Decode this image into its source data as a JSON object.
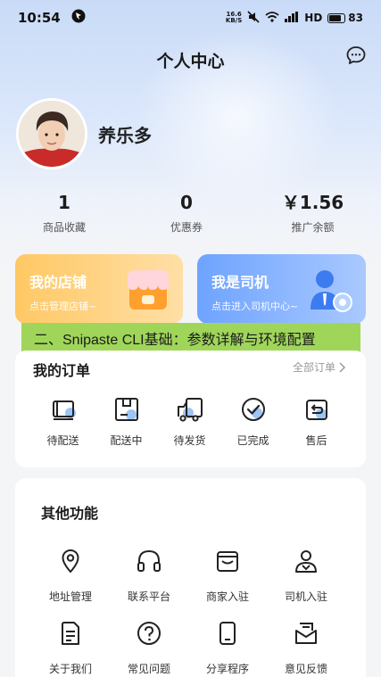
{
  "status_bar": {
    "time": "10:54",
    "net_speed_value": "16.6",
    "net_speed_unit": "KB/S",
    "network": "HD",
    "battery": "83"
  },
  "header": {
    "title": "个人中心",
    "message_icon": "chat-bubble-icon"
  },
  "profile": {
    "name": "养乐多"
  },
  "stats": [
    {
      "value": "1",
      "label": "商品收藏"
    },
    {
      "value": "0",
      "label": "优惠券"
    },
    {
      "value": "￥1.56",
      "label": "推广余额"
    }
  ],
  "promos": [
    {
      "title": "我的店铺",
      "subtitle": "点击管理店铺~",
      "icon": "shop-icon",
      "color": "#ffc864"
    },
    {
      "title": "我是司机",
      "subtitle": "点击进入司机中心~",
      "icon": "driver-icon",
      "color": "#6ea3ff"
    }
  ],
  "overlay_banner": {
    "text": "二、Snipaste CLI基础：参数详解与环境配置",
    "color": "#9fd65a"
  },
  "orders": {
    "title": "我的订单",
    "all_label": "全部订单",
    "items": [
      {
        "label": "待配送",
        "icon": "package-icon"
      },
      {
        "label": "配送中",
        "icon": "delivery-box-icon"
      },
      {
        "label": "待发货",
        "icon": "truck-icon"
      },
      {
        "label": "已完成",
        "icon": "check-circle-icon"
      },
      {
        "label": "售后",
        "icon": "return-icon"
      }
    ]
  },
  "other_functions": {
    "title": "其他功能",
    "items": [
      {
        "label": "地址管理",
        "icon": "location-pin-icon"
      },
      {
        "label": "联系平台",
        "icon": "headphones-icon"
      },
      {
        "label": "商家入驻",
        "icon": "store-icon"
      },
      {
        "label": "司机入驻",
        "icon": "driver-person-icon"
      },
      {
        "label": "关于我们",
        "icon": "document-icon"
      },
      {
        "label": "常见问题",
        "icon": "question-icon"
      },
      {
        "label": "分享程序",
        "icon": "phone-icon"
      },
      {
        "label": "意见反馈",
        "icon": "feedback-mail-icon"
      }
    ]
  },
  "colors": {
    "accent_blue": "#6ea3ff",
    "accent_orange": "#ffc864",
    "icon_highlight": "#9cc4f5"
  }
}
